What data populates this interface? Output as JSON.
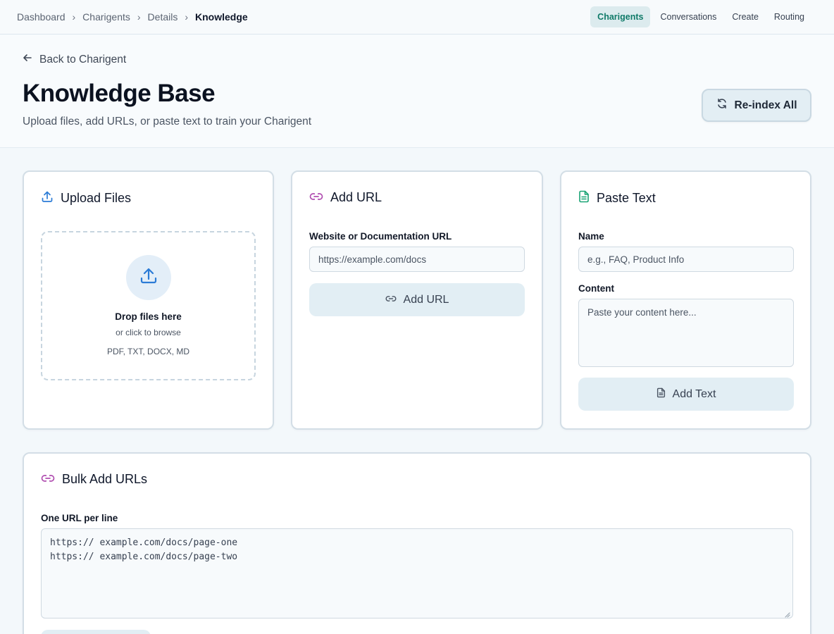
{
  "breadcrumb": {
    "items": [
      "Dashboard",
      "Charigents",
      "Details"
    ],
    "current": "Knowledge"
  },
  "nav": {
    "links": [
      "Charigents",
      "Conversations",
      "Create",
      "Routing"
    ]
  },
  "header": {
    "back_label": "Back to Charigent",
    "title": "Knowledge Base",
    "subtitle": "Upload files, add URLs, or paste text to train your Charigent",
    "reindex_label": "Re-index All"
  },
  "upload": {
    "title": "Upload Files",
    "drop_title": "Drop files here",
    "drop_sub": "or click to browse",
    "drop_types": "PDF, TXT, DOCX, MD"
  },
  "add_url": {
    "title": "Add URL",
    "field_label": "Website or Documentation URL",
    "placeholder": "https://example.com/docs",
    "button_label": "Add URL"
  },
  "paste_text": {
    "title": "Paste Text",
    "name_label": "Name",
    "name_placeholder": "e.g., FAQ, Product Info",
    "content_label": "Content",
    "content_placeholder": "Paste your content here...",
    "button_label": "Add Text"
  },
  "bulk": {
    "title": "Bulk Add URLs",
    "field_label": "One URL per line",
    "lines": [
      "https:// example.com/docs/page-one",
      "https:// example.com/docs/page-two"
    ]
  },
  "colors": {
    "accent_teal": "#0f7a68",
    "upload_icon": "#2b7bd6",
    "link_icon": "#b04db0",
    "text_icon": "#19a374"
  },
  "icons": {
    "back": "arrow-left-icon",
    "reindex": "refresh-icon",
    "upload": "upload-icon",
    "link": "link-icon",
    "text": "document-icon"
  }
}
